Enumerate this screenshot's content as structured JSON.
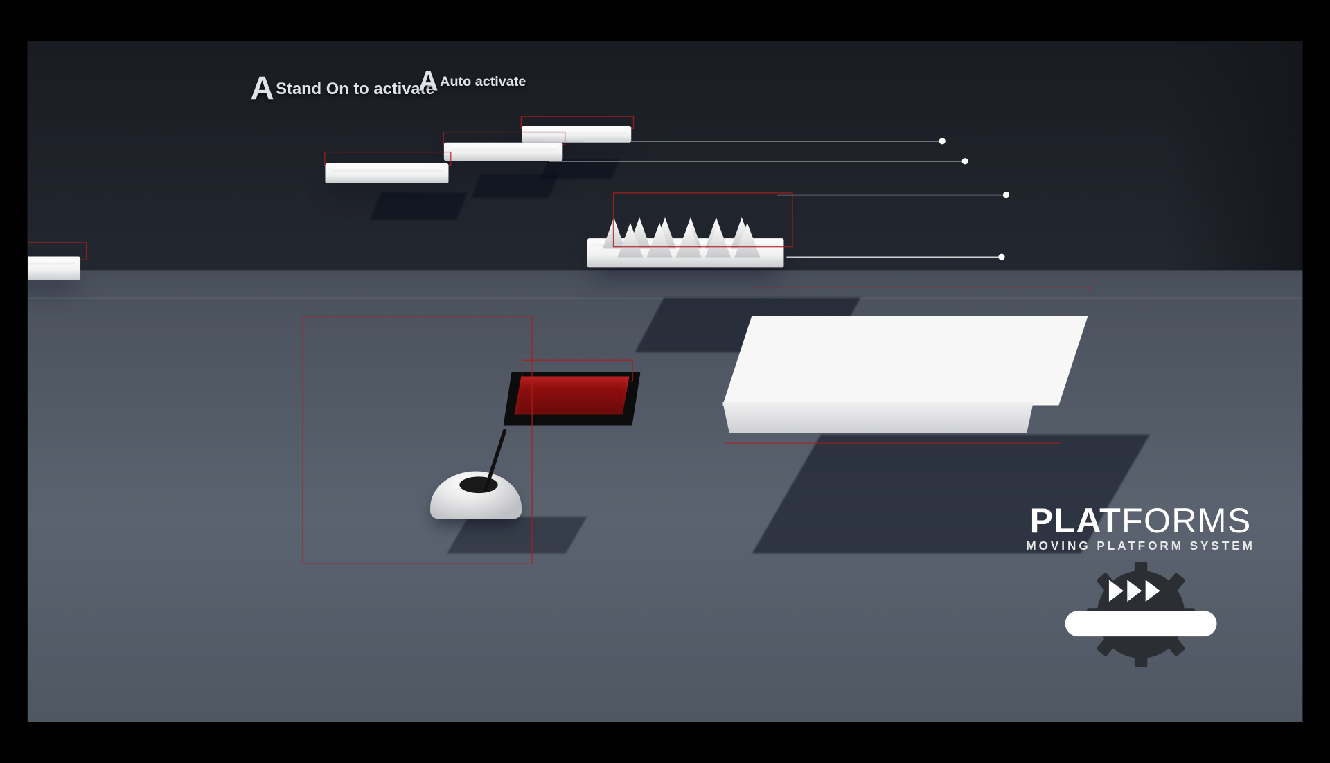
{
  "labels": {
    "stand_on": "Stand On to activate",
    "auto": "Auto activate",
    "marker": "A"
  },
  "logo": {
    "title_left": "PLAT",
    "title_right": "FORMS",
    "subtitle": "MOVING PLATFORM SYSTEM"
  },
  "colors": {
    "wire": "#a01e1e",
    "pad": "#8a0d0d",
    "platform": "#f6f6f7",
    "floor": "#565e6a"
  }
}
